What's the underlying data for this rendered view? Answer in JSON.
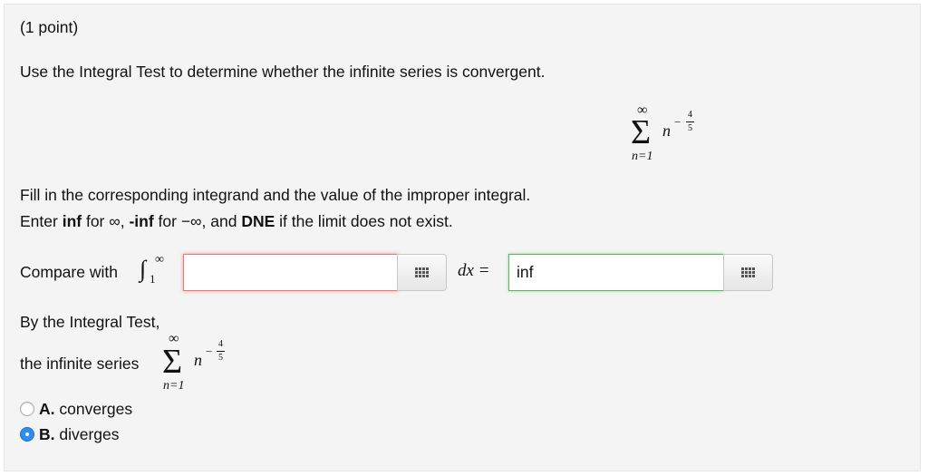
{
  "problem": {
    "points": "(1 point)",
    "instruction": "Use the Integral Test to determine whether the infinite series is convergent.",
    "fill_text": "Fill in the corresponding integrand and the value of the improper integral.",
    "enter_inf": "inf",
    "enter_neg_inf": "-inf",
    "enter_dne": "DNE",
    "enter_prefix": "Enter ",
    "enter_for1": " for ∞, ",
    "enter_for2": " for −∞, and ",
    "enter_suffix": " if the limit does not exist."
  },
  "series": {
    "upper": "∞",
    "sigma": "Σ",
    "term_base": "n",
    "exp_sign": "−",
    "exp_num": "4",
    "exp_den": "5",
    "lower": "n=1"
  },
  "compare": {
    "label": "Compare with",
    "integral_sign": "∫",
    "lower_limit": "1",
    "upper_limit": "∞",
    "integrand_value": "",
    "dx_label": "dx =",
    "integral_value": "inf"
  },
  "conclusion": {
    "by_test": "By the Integral Test,",
    "series_label": "the infinite series",
    "options": [
      {
        "letter": "A.",
        "text": " converges",
        "selected": false
      },
      {
        "letter": "B.",
        "text": " diverges",
        "selected": true
      }
    ]
  },
  "icons": {
    "grid_button": "grid-icon"
  }
}
